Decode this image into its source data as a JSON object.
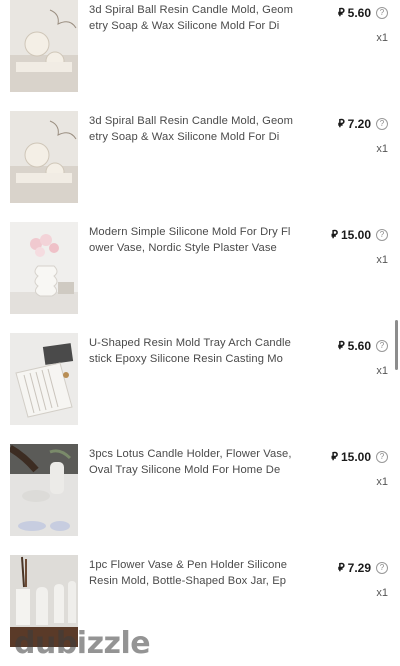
{
  "currency_symbol": "⃃",
  "items": [
    {
      "title": "3d Spiral Ball Resin Candle Mold,  Geometry Soap & Wax Silicone Mold For Di",
      "price": "5.60",
      "qty": "x1",
      "image": "spiral-ball-candle-image"
    },
    {
      "title": "3d Spiral Ball Resin Candle Mold,  Geometry Soap & Wax Silicone Mold For Di",
      "price": "7.20",
      "qty": "x1",
      "image": "spiral-ball-candle-image"
    },
    {
      "title": "Modern Simple Silicone Mold For Dry Flower Vase, Nordic Style Plaster Vase",
      "price": "15.00",
      "qty": "x1",
      "image": "flower-vase-image"
    },
    {
      "title": "U-Shaped Resin Mold Tray Arch Candlestick Epoxy Silicone Resin Casting Mo",
      "price": "5.60",
      "qty": "x1",
      "image": "arch-tray-image"
    },
    {
      "title": "3pcs Lotus Candle Holder, Flower Vase, Oval Tray Silicone Mold For Home De",
      "price": "15.00",
      "qty": "x1",
      "image": "lotus-holder-image"
    },
    {
      "title": "1pc Flower Vase & Pen Holder Silicone Resin Mold, Bottle-Shaped Box Jar, Ep",
      "price": "7.29",
      "qty": "x1",
      "image": "bottle-vase-image"
    }
  ],
  "watermark": "dubizzle"
}
